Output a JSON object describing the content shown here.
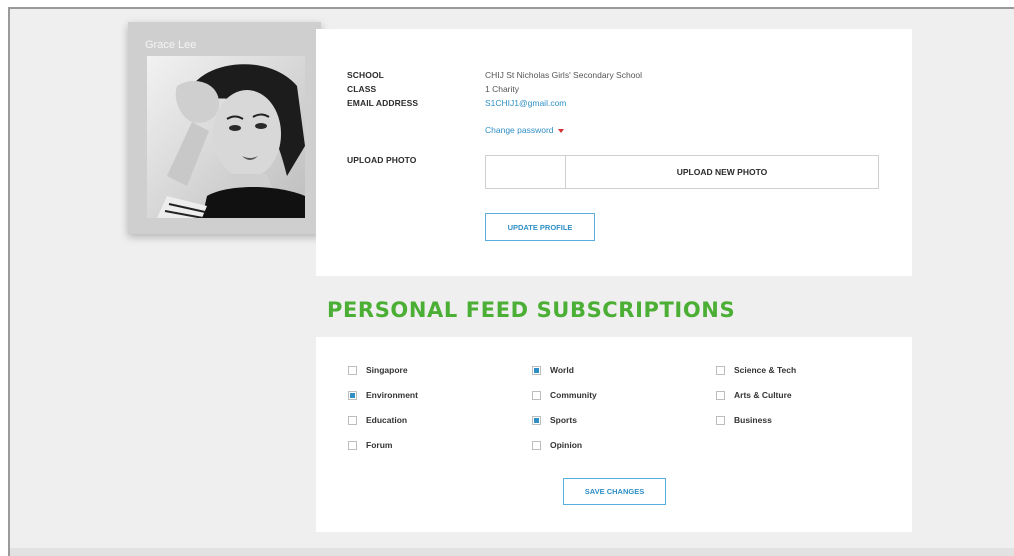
{
  "profile": {
    "name": "Grace Lee",
    "photo_icon": "user-photo",
    "school_label": "SCHOOL",
    "school_value": "CHIJ St Nicholas Girls' Secondary School",
    "class_label": "CLASS",
    "class_value": "1 Charity",
    "email_label": "EMAIL ADDRESS",
    "email_value": "S1CHIJ1@gmail.com",
    "change_password": "Change password",
    "upload_label": "UPLOAD PHOTO",
    "upload_button": "UPLOAD NEW PHOTO",
    "update_button": "UPDATE PROFILE"
  },
  "subscriptions": {
    "heading": "PERSONAL FEED SUBSCRIPTIONS",
    "accent_color": "#4caf35",
    "checkbox_color": "#2f8fc6",
    "items": [
      {
        "label": "Singapore",
        "checked": false
      },
      {
        "label": "World",
        "checked": true
      },
      {
        "label": "Science & Tech",
        "checked": false
      },
      {
        "label": "Environment",
        "checked": true
      },
      {
        "label": "Community",
        "checked": false
      },
      {
        "label": "Arts & Culture",
        "checked": false
      },
      {
        "label": "Education",
        "checked": false
      },
      {
        "label": "Sports",
        "checked": true
      },
      {
        "label": "Business",
        "checked": false
      },
      {
        "label": "Forum",
        "checked": false
      },
      {
        "label": "Opinion",
        "checked": false
      }
    ],
    "save_button": "SAVE CHANGES"
  }
}
